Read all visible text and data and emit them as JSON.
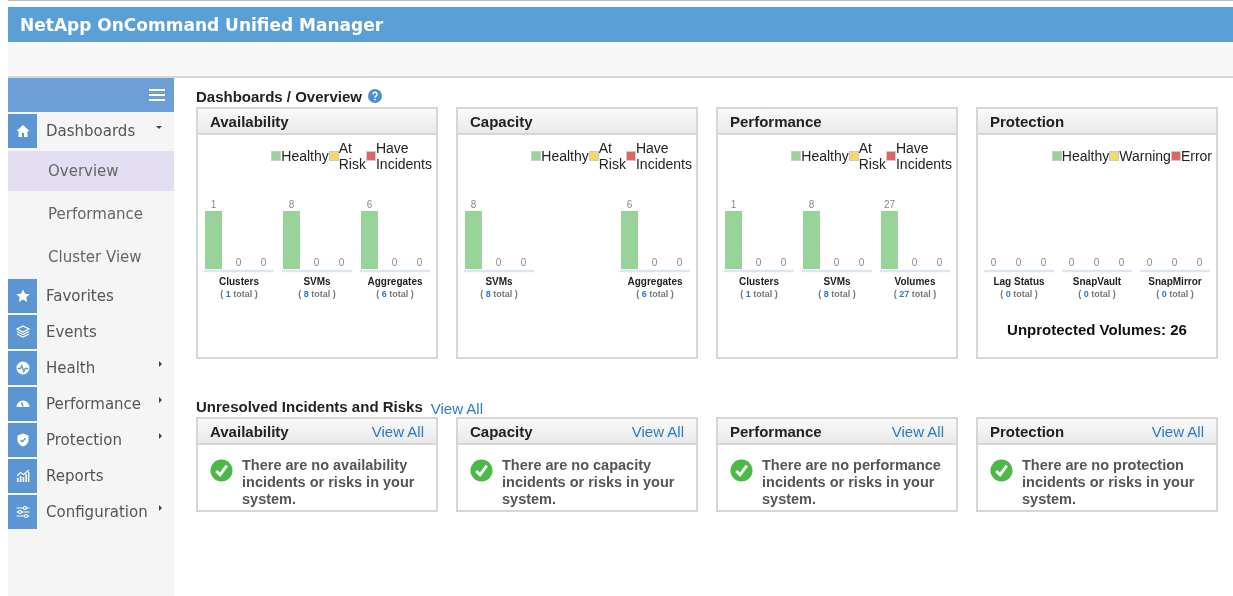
{
  "app": {
    "title": "NetApp OnCommand Unified Manager"
  },
  "sidebar": {
    "items": [
      {
        "label": "Dashboards",
        "expanded": true,
        "children": [
          {
            "label": "Overview",
            "selected": true
          },
          {
            "label": "Performance",
            "selected": false
          },
          {
            "label": "Cluster View",
            "selected": false
          }
        ]
      },
      {
        "label": "Favorites"
      },
      {
        "label": "Events"
      },
      {
        "label": "Health",
        "expanded": false
      },
      {
        "label": "Performance",
        "expanded": false
      },
      {
        "label": "Protection",
        "expanded": false
      },
      {
        "label": "Reports"
      },
      {
        "label": "Configuration",
        "expanded": false
      }
    ]
  },
  "page": {
    "breadcrumb": "Dashboards / Overview"
  },
  "summary_cards": [
    {
      "title": "Availability",
      "legend": [
        {
          "label": "Healthy",
          "color": "#98d39a"
        },
        {
          "label": "At Risk",
          "color": "#f5d76e"
        },
        {
          "label": "Have Incidents",
          "color": "#e06666"
        }
      ],
      "groups": [
        {
          "label": "Clusters",
          "counts": [
            "1",
            "0",
            "0"
          ],
          "total": "( **1** total )"
        },
        {
          "label": "SVMs",
          "counts": [
            "8",
            "0",
            "0"
          ],
          "total": "( **8** total )"
        },
        {
          "label": "Aggregates",
          "counts": [
            "6",
            "0",
            "0"
          ],
          "total": "( **6** total )"
        }
      ]
    },
    {
      "title": "Capacity",
      "legend": [
        {
          "label": "Healthy",
          "color": "#98d39a"
        },
        {
          "label": "At Risk",
          "color": "#f5d76e"
        },
        {
          "label": "Have Incidents",
          "color": "#e06666"
        }
      ],
      "groups": [
        {
          "label": "SVMs",
          "counts": [
            "8",
            "0",
            "0"
          ],
          "total": "( **8** total )"
        },
        {
          "label": "Aggregates",
          "counts": [
            "6",
            "0",
            "0"
          ],
          "total": "( **6** total )"
        }
      ]
    },
    {
      "title": "Performance",
      "legend": [
        {
          "label": "Healthy",
          "color": "#98d39a"
        },
        {
          "label": "At Risk",
          "color": "#f5d76e"
        },
        {
          "label": "Have Incidents",
          "color": "#e06666"
        }
      ],
      "groups": [
        {
          "label": "Clusters",
          "counts": [
            "1",
            "0",
            "0"
          ],
          "total": "( **1** total )"
        },
        {
          "label": "SVMs",
          "counts": [
            "8",
            "0",
            "0"
          ],
          "total": "( **8** total )"
        },
        {
          "label": "Volumes",
          "counts": [
            "27",
            "0",
            "0"
          ],
          "total": "( **27** total )"
        }
      ]
    },
    {
      "title": "Protection",
      "legend": [
        {
          "label": "Healthy",
          "color": "#98d39a"
        },
        {
          "label": "Warning",
          "color": "#f5d76e"
        },
        {
          "label": "Error",
          "color": "#e06666"
        }
      ],
      "groups": [
        {
          "label": "Lag Status",
          "counts": [
            "0",
            "0",
            "0"
          ],
          "total": "( **0** total )"
        },
        {
          "label": "SnapVault",
          "counts": [
            "0",
            "0",
            "0"
          ],
          "total": "( **0** total )"
        },
        {
          "label": "SnapMirror",
          "counts": [
            "0",
            "0",
            "0"
          ],
          "total": "( **0** total )"
        }
      ],
      "footer": "Unprotected Volumes: 26"
    }
  ],
  "incidents": {
    "title": "Unresolved Incidents and Risks",
    "link": "View All",
    "cards": [
      {
        "title": "Availability",
        "link": "View All",
        "message": "There are no availability incidents or risks in your system."
      },
      {
        "title": "Capacity",
        "link": "View All",
        "message": "There are no capacity incidents or risks in your system."
      },
      {
        "title": "Performance",
        "link": "View All",
        "message": "There are no performance incidents or risks in your system."
      },
      {
        "title": "Protection",
        "link": "View All",
        "message": "There are no protection incidents or risks in your system."
      }
    ]
  }
}
